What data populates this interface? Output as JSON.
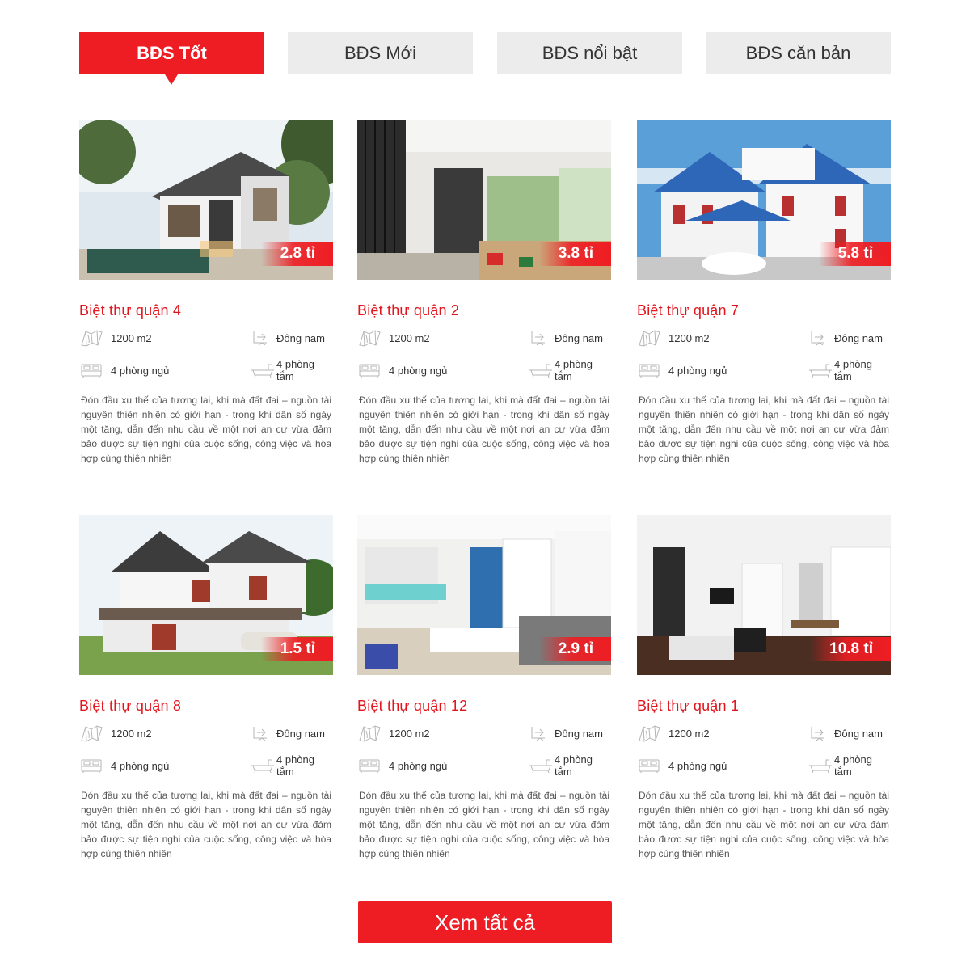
{
  "tabs": [
    {
      "label": "BĐS Tốt",
      "active": true
    },
    {
      "label": "BĐS Mới",
      "active": false
    },
    {
      "label": "BĐS nổi bật",
      "active": false
    },
    {
      "label": "BĐS căn bản",
      "active": false
    }
  ],
  "listings": [
    {
      "title": "Biệt thự quận 4",
      "price": "2.8 tỉ",
      "area": "1200 m2",
      "direction": "Đông nam",
      "bedrooms": "4 phòng ngủ",
      "bathrooms": "4 phòng tắm",
      "description": "Đón đầu xu thế của tương lai, khi mà đất đai – nguồn tài nguyên thiên nhiên có giới hạn - trong khi dân số ngày một tăng, dẫn đến nhu cầu về một nơi an cư vừa đảm bảo được sự tiện nghi của cuộc sống, công việc và hòa hợp cùng thiên nhiên",
      "image": "modern-villa-pool"
    },
    {
      "title": "Biệt thự quận 2",
      "price": "3.8 tỉ",
      "area": "1200 m2",
      "direction": "Đông nam",
      "bedrooms": "4 phòng ngủ",
      "bathrooms": "4 phòng tắm",
      "description": "Đón đầu xu thế của tương lai, khi mà đất đai – nguồn tài nguyên thiên nhiên có giới hạn - trong khi dân số ngày một tăng, dẫn đến nhu cầu về một nơi an cư vừa đảm bảo được sự tiện nghi của cuộc sống, công việc và hòa hợp cùng thiên nhiên",
      "image": "modern-interior-hall"
    },
    {
      "title": "Biệt thự quận 7",
      "price": "5.8 tỉ",
      "area": "1200 m2",
      "direction": "Đông nam",
      "bedrooms": "4 phòng ngủ",
      "bathrooms": "4 phòng tắm",
      "description": "Đón đầu xu thế của tương lai, khi mà đất đai – nguồn tài nguyên thiên nhiên có giới hạn - trong khi dân số ngày một tăng, dẫn đến nhu cầu về một nơi an cư vừa đảm bảo được sự tiện nghi của cuộc sống, công việc và hòa hợp cùng thiên nhiên",
      "image": "white-villa-blue-roof"
    },
    {
      "title": "Biệt thự quận 8",
      "price": "1.5 tỉ",
      "area": "1200 m2",
      "direction": "Đông nam",
      "bedrooms": "4 phòng ngủ",
      "bathrooms": "4 phòng tắm",
      "description": "Đón đầu xu thế của tương lai, khi mà đất đai – nguồn tài nguyên thiên nhiên có giới hạn - trong khi dân số ngày một tăng, dẫn đến nhu cầu về một nơi an cư vừa đảm bảo được sự tiện nghi của cuộc sống, công việc và hòa hợp cùng thiên nhiên",
      "image": "two-story-house-car"
    },
    {
      "title": "Biệt thự quận 12",
      "price": "2.9 tỉ",
      "area": "1200 m2",
      "direction": "Đông nam",
      "bedrooms": "4 phòng ngủ",
      "bathrooms": "4 phòng tắm",
      "description": "Đón đầu xu thế của tương lai, khi mà đất đai – nguồn tài nguyên thiên nhiên có giới hạn - trong khi dân số ngày một tăng, dẫn đến nhu cầu về một nơi an cư vừa đảm bảo được sự tiện nghi của cuộc sống, công việc và hòa hợp cùng thiên nhiên",
      "image": "living-room-kitchen"
    },
    {
      "title": "Biệt thự quận 1",
      "price": "10.8 tỉ",
      "area": "1200 m2",
      "direction": "Đông nam",
      "bedrooms": "4 phòng ngủ",
      "bathrooms": "4 phòng tắm",
      "description": "Đón đầu xu thế của tương lai, khi mà đất đai – nguồn tài nguyên thiên nhiên có giới hạn - trong khi dân số ngày một tăng, dẫn đến nhu cầu về một nơi an cư vừa đảm bảo được sự tiện nghi của cuộc sống, công việc và hòa hợp cùng thiên nhiên",
      "image": "open-plan-stove-room"
    }
  ],
  "view_all_label": "Xem tất cả",
  "colors": {
    "accent": "#ee1d23",
    "tab_inactive": "#ececec",
    "title": "#e3141c"
  }
}
